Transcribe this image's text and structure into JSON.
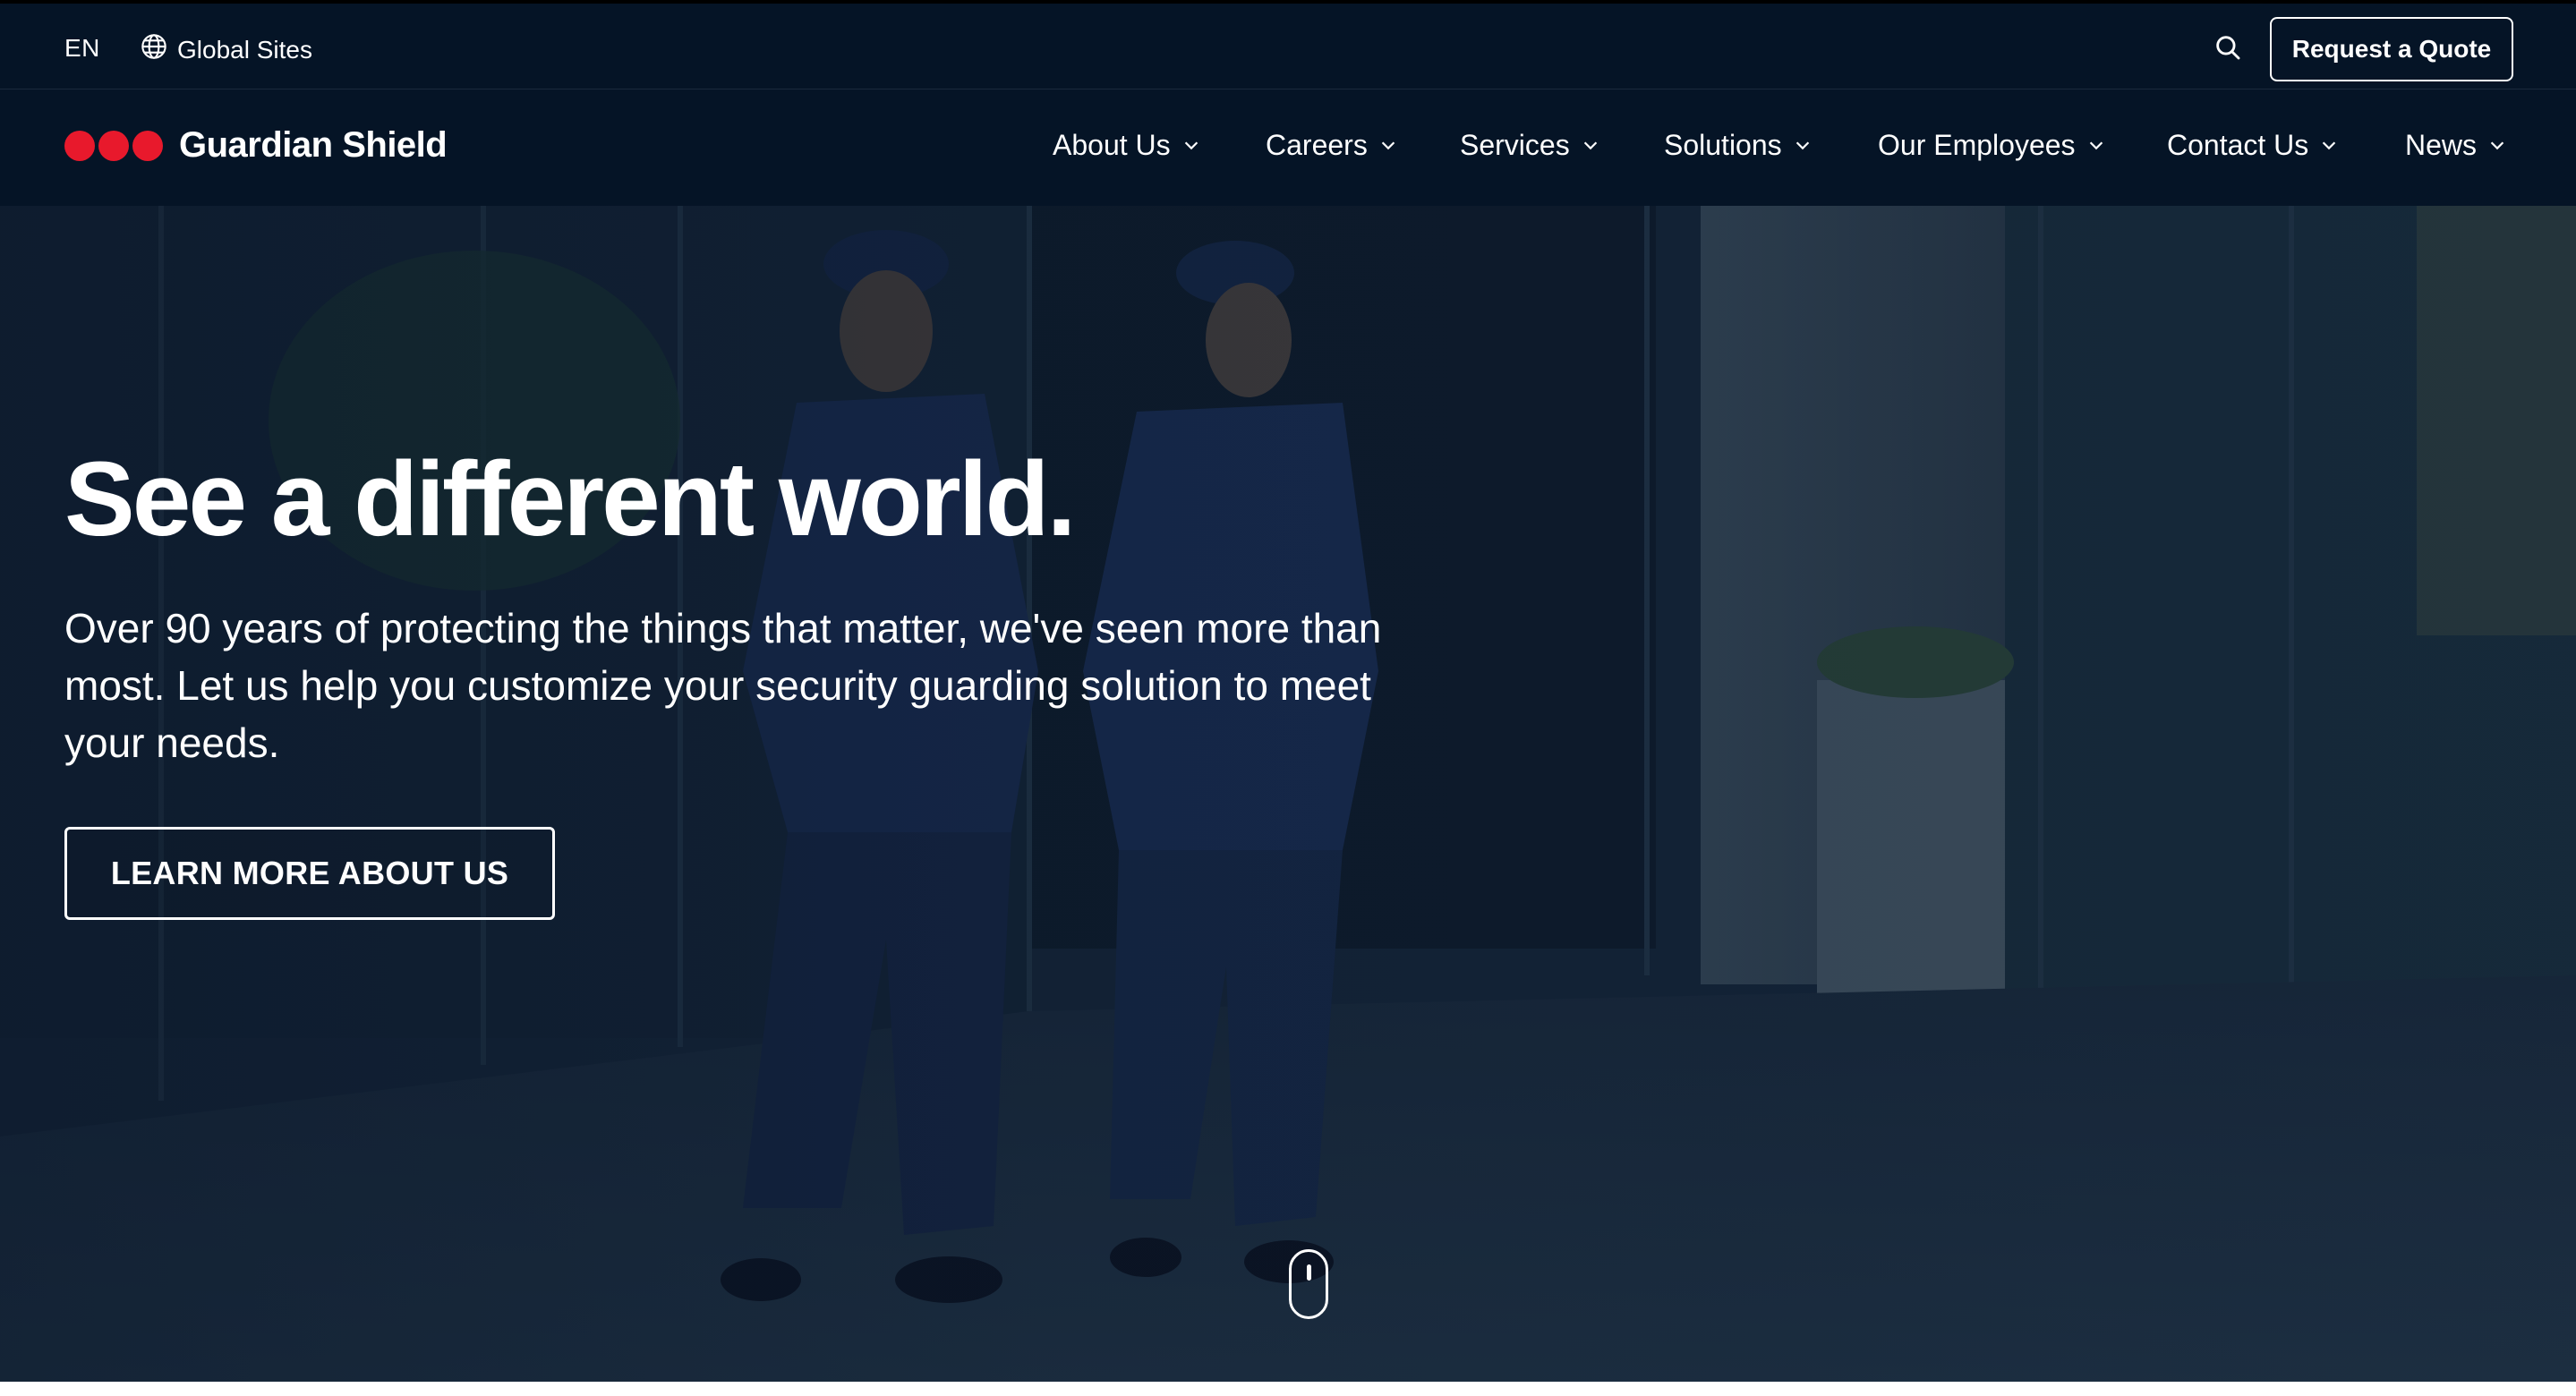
{
  "topbar": {
    "language": "EN",
    "global_sites_label": "Global Sites",
    "globe_icon": "globe-icon",
    "search_icon": "search-icon",
    "quote_button_label": "Request a Quote"
  },
  "brand": {
    "name": "Guardian Shield",
    "logo_color": "#e8192c"
  },
  "nav": {
    "items": [
      {
        "label": "About Us"
      },
      {
        "label": "Careers"
      },
      {
        "label": "Services"
      },
      {
        "label": "Solutions"
      },
      {
        "label": "Our Employees"
      },
      {
        "label": "Contact Us"
      },
      {
        "label": "News"
      }
    ]
  },
  "hero": {
    "title": "See a different world.",
    "subtitle": "Over 90 years of protecting the things that matter, we've seen more than most. Let us help you customize your security guarding solution to meet your needs.",
    "cta_label": "LEARN MORE ABOUT US"
  },
  "colors": {
    "header_bg": "#051426",
    "accent": "#e8192c",
    "text": "#ffffff"
  }
}
